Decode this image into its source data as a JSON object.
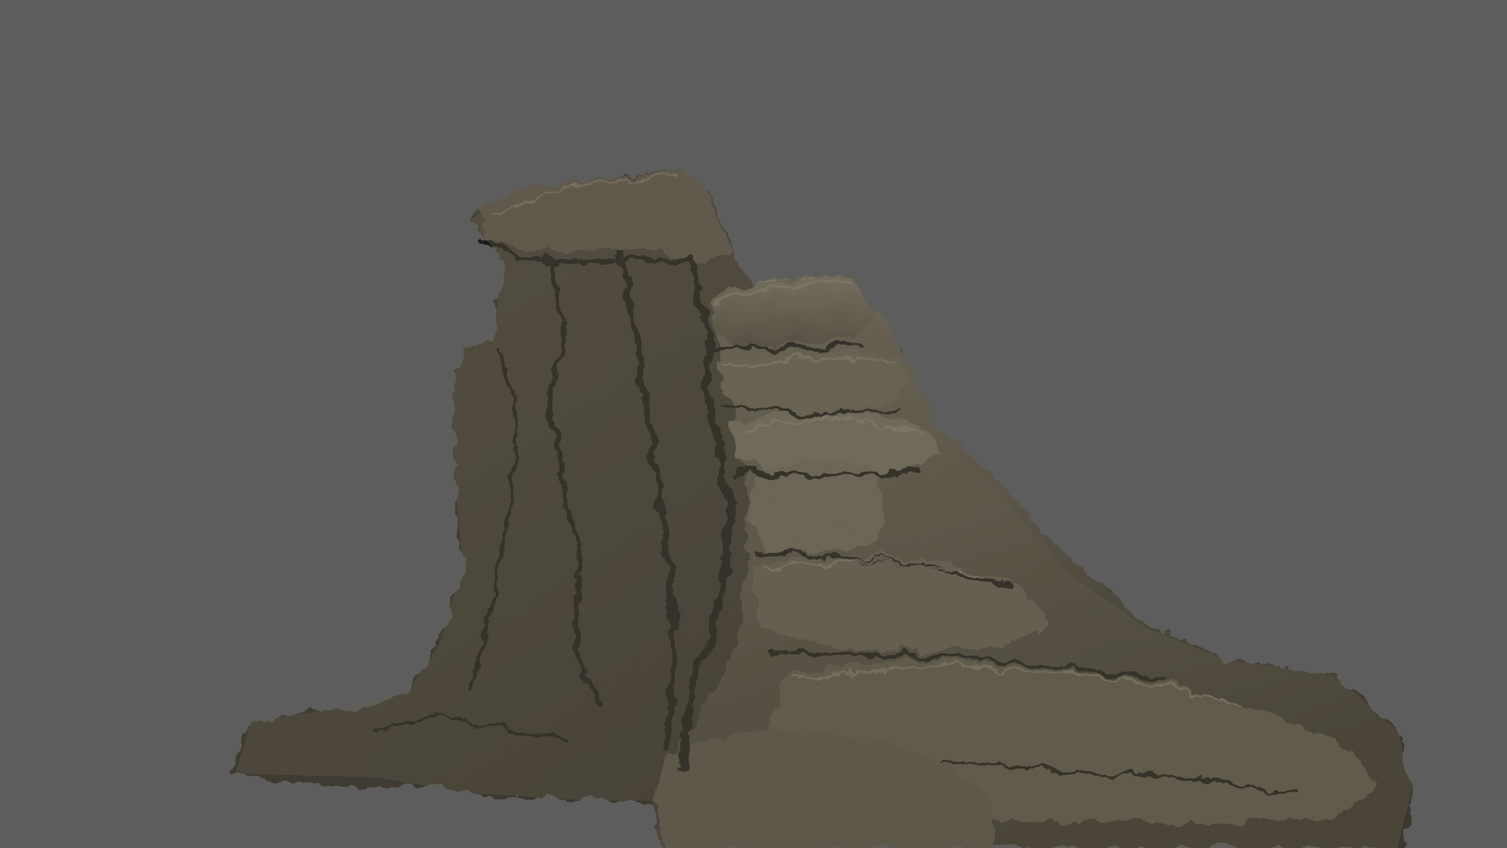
{
  "scene": {
    "subject": "rock-formation",
    "background_color": "#5d5d5d",
    "palette": {
      "rock_dark": "#2e2b24",
      "rock_mid": "#4a453a",
      "rock_light": "#6e685a",
      "rock_highlight": "#8c8676",
      "shadow": "#1c1a16"
    }
  }
}
